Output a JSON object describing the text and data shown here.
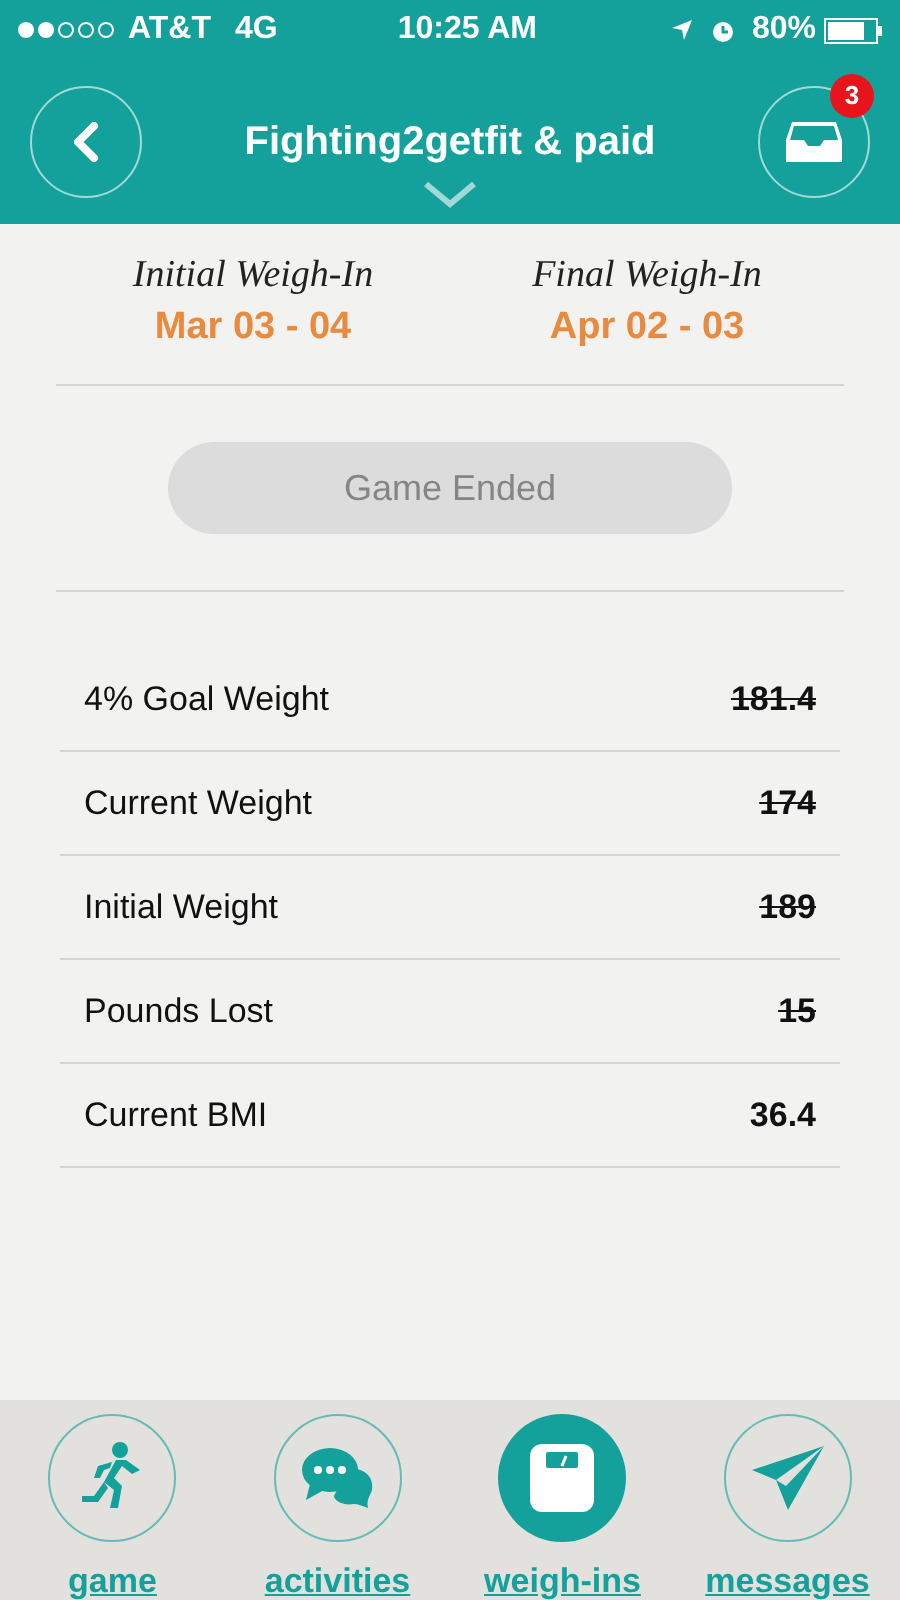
{
  "status_bar": {
    "carrier": "AT&T",
    "network": "4G",
    "time": "10:25 AM",
    "battery": "80%"
  },
  "header": {
    "title": "Fighting2getfit & paid",
    "inbox_badge": "3"
  },
  "weigh_ins": [
    {
      "label": "Initial Weigh-In",
      "dates": "Mar 03 - 04"
    },
    {
      "label": "Final Weigh-In",
      "dates": "Apr 02 - 03"
    }
  ],
  "status_button": {
    "label": "Game Ended",
    "disabled": true
  },
  "stats": [
    {
      "label": "4% Goal Weight",
      "value": "181.4",
      "struck": true
    },
    {
      "label": "Current Weight",
      "value": "174",
      "struck": true
    },
    {
      "label": "Initial Weight",
      "value": "189",
      "struck": true
    },
    {
      "label": "Pounds Lost",
      "value": "15",
      "struck": true
    },
    {
      "label": "Current BMI",
      "value": "36.4",
      "struck": false
    }
  ],
  "tab_bar": [
    {
      "kind": "runner",
      "label": "game",
      "selected": false
    },
    {
      "kind": "chat",
      "label": "activities",
      "selected": false
    },
    {
      "kind": "scale",
      "label": "weigh-ins",
      "selected": true
    },
    {
      "kind": "plane",
      "label": "messages",
      "selected": false
    }
  ]
}
